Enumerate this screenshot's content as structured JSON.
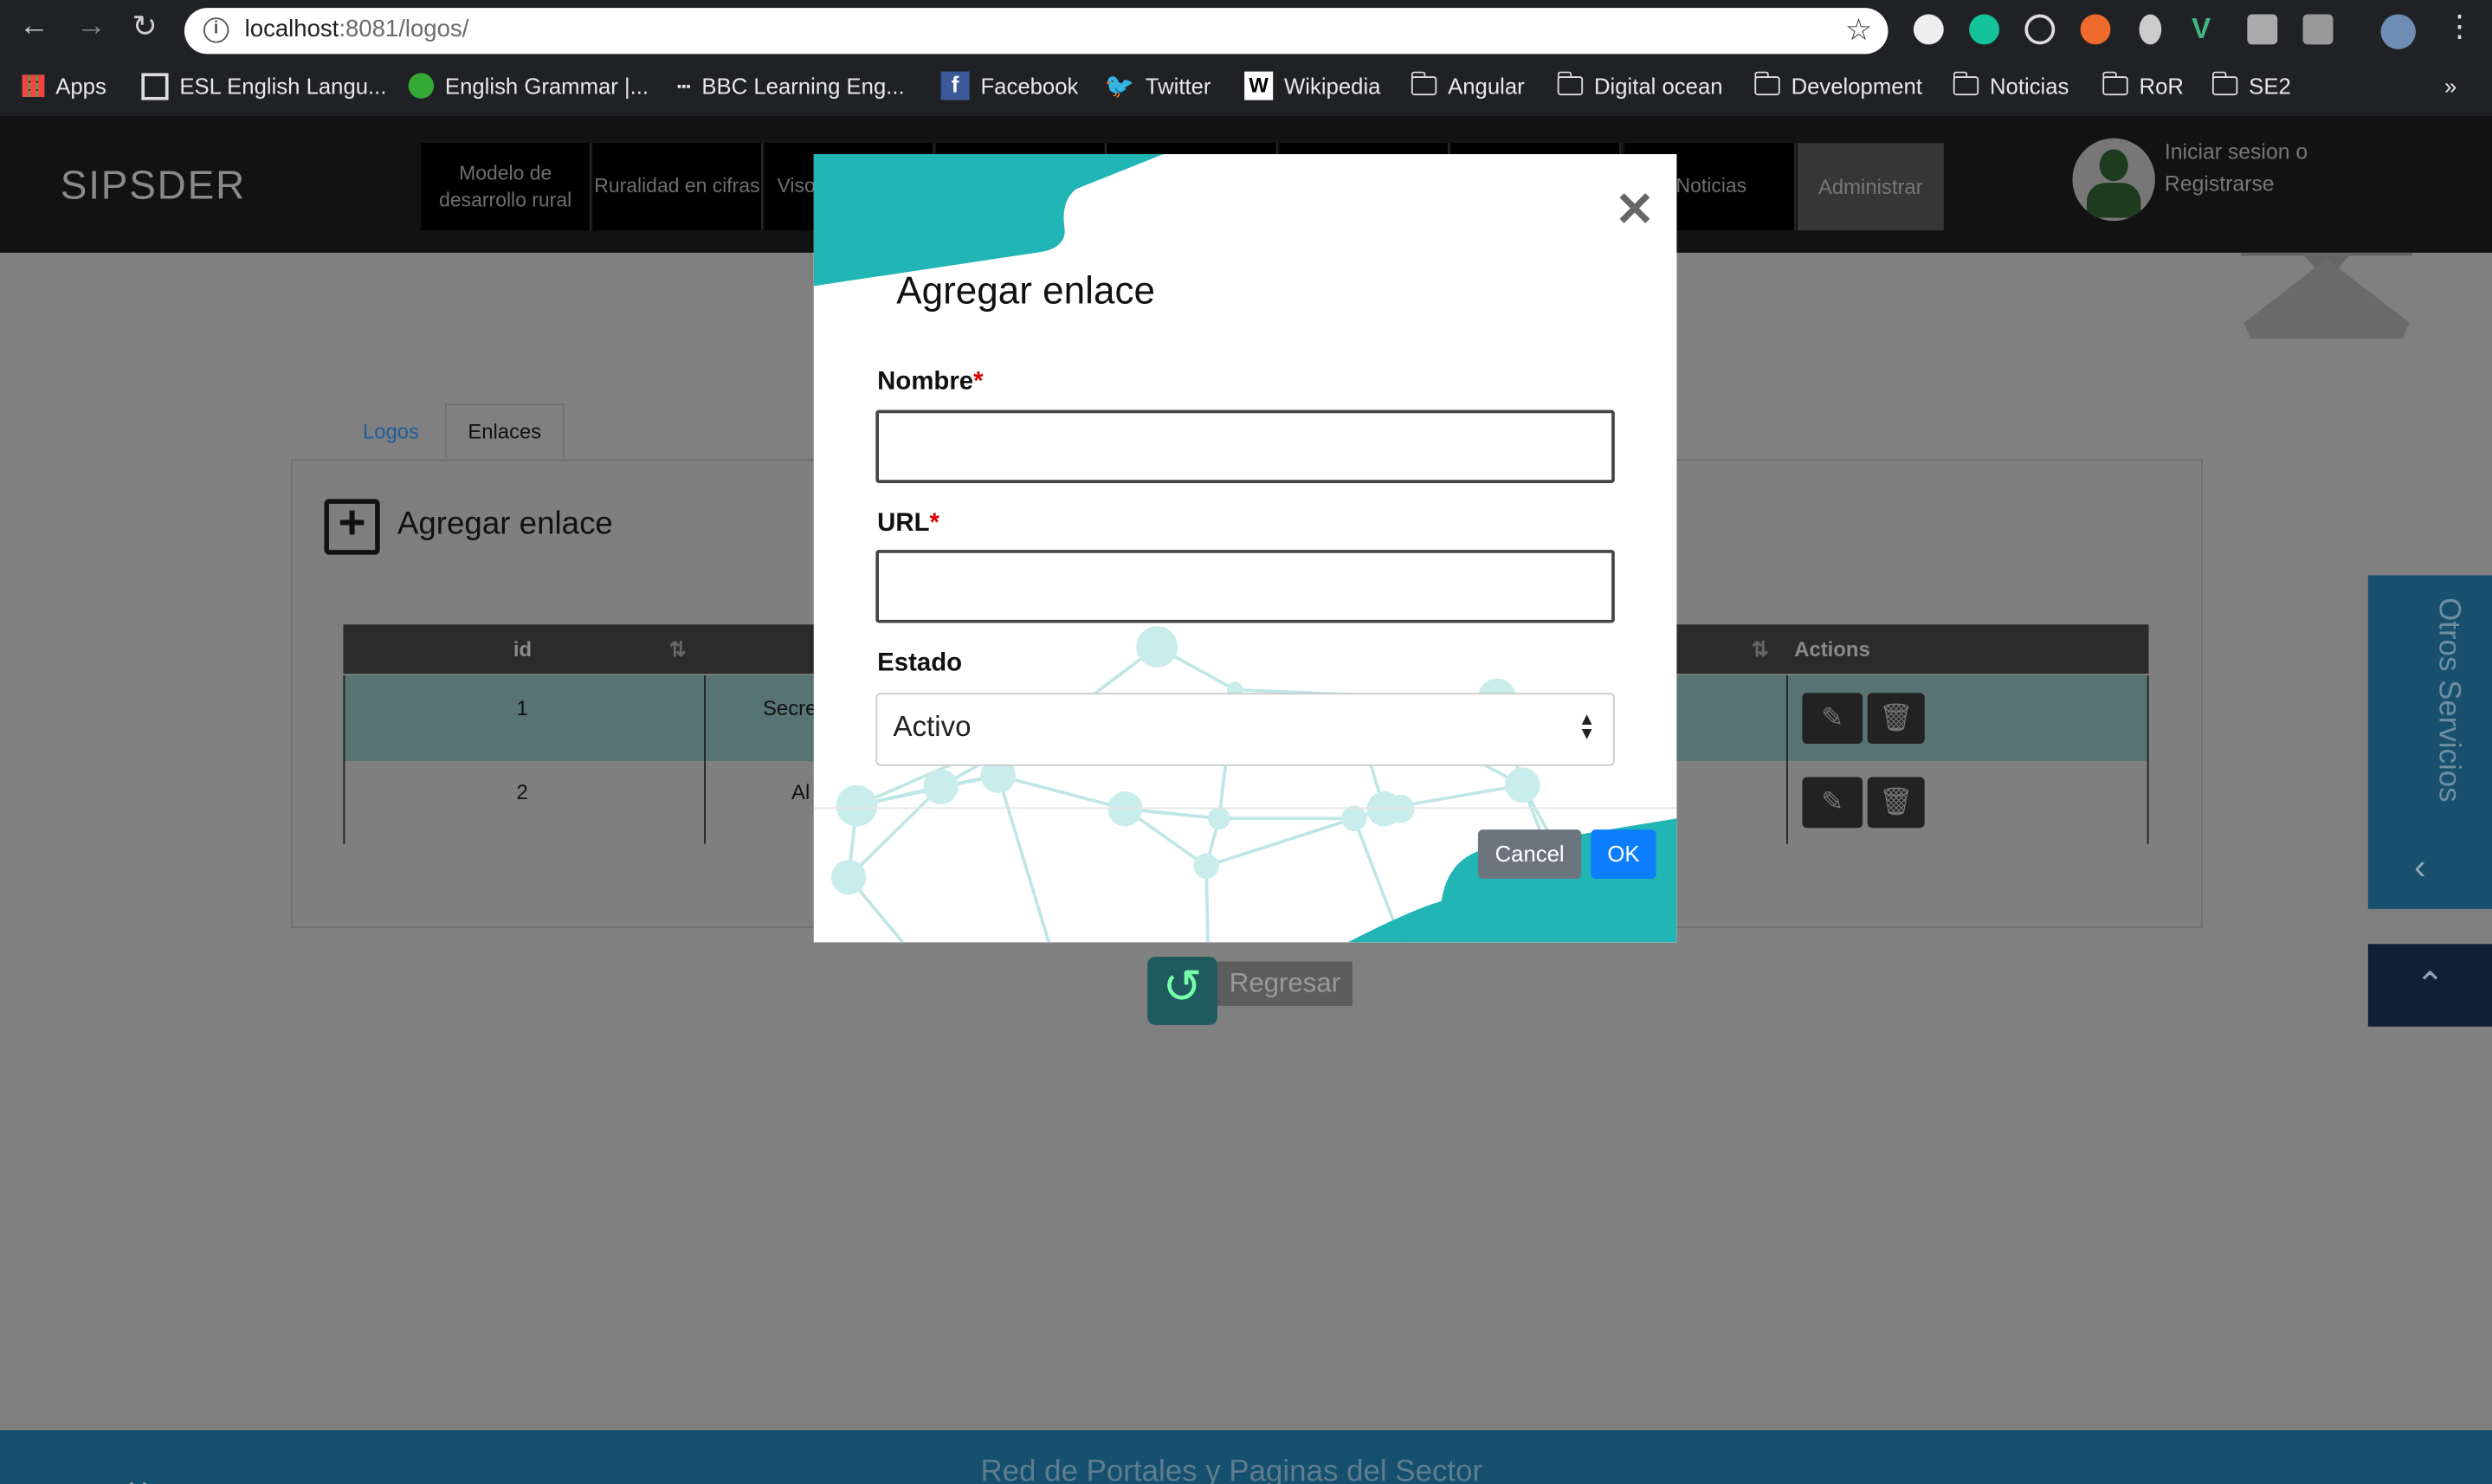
{
  "browser": {
    "url_host": "localhost",
    "url_rest": ":8081/logos/",
    "bookmarks": [
      {
        "label": "Apps"
      },
      {
        "label": "ESL English Langu..."
      },
      {
        "label": "English Grammar |..."
      },
      {
        "label": "BBC Learning Eng..."
      },
      {
        "label": "Facebook"
      },
      {
        "label": "Twitter"
      },
      {
        "label": "Wikipedia"
      },
      {
        "label": "Angular"
      },
      {
        "label": "Digital ocean"
      },
      {
        "label": "Development"
      },
      {
        "label": "Noticias"
      },
      {
        "label": "RoR"
      },
      {
        "label": "SE2"
      }
    ],
    "more": "»"
  },
  "site": {
    "logo": "SIPSDER",
    "nav": [
      {
        "label": "Modelo de desarrollo rural"
      },
      {
        "label": "Ruralidad en cifras"
      },
      {
        "label": "Viso"
      },
      {
        "label": "Noticias"
      },
      {
        "label": "Administrar"
      }
    ],
    "login": "Iniciar sesion o Registrarse"
  },
  "page": {
    "tabs": [
      {
        "label": "Logos"
      },
      {
        "label": "Enlaces"
      }
    ],
    "add_title": "Agregar enlace",
    "table": {
      "headers": [
        "id",
        "Actions"
      ],
      "rows": [
        {
          "id": "1",
          "name": "Secre"
        },
        {
          "id": "2",
          "name": "Al"
        }
      ]
    },
    "back_label": "Regresar",
    "otros": "Otros Servicios",
    "footer": "Red de Portales y Paginas del Sector"
  },
  "modal": {
    "title": "Agregar enlace",
    "fields": [
      {
        "label": "Nombre",
        "required": "*",
        "value": ""
      },
      {
        "label": "URL",
        "required": "*",
        "value": ""
      }
    ],
    "estado_label": "Estado",
    "estado_value": "Activo",
    "cancel": "Cancel",
    "ok": "OK"
  },
  "colors": {
    "teal": "#22b5b5",
    "ok_blue": "#0d7dff"
  }
}
